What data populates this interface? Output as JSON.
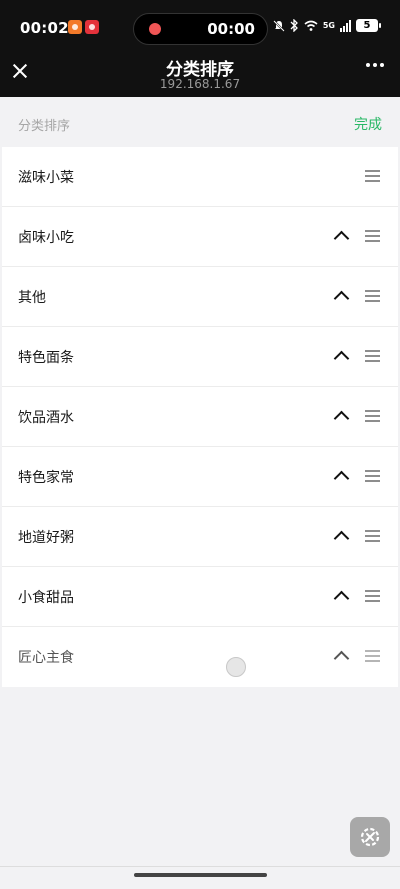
{
  "status_bar": {
    "time": "00:02",
    "recording_time": "00:00",
    "network": "5G",
    "battery": "5"
  },
  "nav": {
    "title": "分类排序",
    "subtitle": "192.168.1.67"
  },
  "section": {
    "title": "分类排序",
    "done_label": "完成"
  },
  "categories": [
    {
      "label": "滋味小菜",
      "has_up": false
    },
    {
      "label": "卤味小吃",
      "has_up": true
    },
    {
      "label": "其他",
      "has_up": true
    },
    {
      "label": "特色面条",
      "has_up": true
    },
    {
      "label": "饮品酒水",
      "has_up": true
    },
    {
      "label": "特色家常",
      "has_up": true
    },
    {
      "label": "地道好粥",
      "has_up": true
    },
    {
      "label": "小食甜品",
      "has_up": true
    },
    {
      "label": "匠心主食",
      "has_up": true
    }
  ],
  "icons": {
    "close": "close-icon",
    "more": "more-icon",
    "up": "chevron-up-icon",
    "drag": "drag-handle-icon",
    "float": "settings-tool-icon"
  },
  "colors": {
    "accent": "#29b866",
    "nav_bg": "#111111",
    "page_bg": "#f2f2f4"
  }
}
